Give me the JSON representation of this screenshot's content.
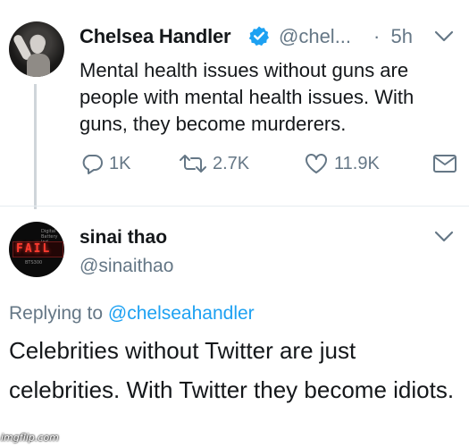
{
  "tweet": {
    "author_name": "Chelsea Handler",
    "author_handle": "@chel...",
    "separator": "·",
    "time": "5h",
    "text": "Mental health issues without guns are people with mental health issues. With guns, they become murderers.",
    "replies_count": "1K",
    "retweets_count": "2.7K",
    "likes_count": "11.9K",
    "icons": {
      "verified": "verified-badge-icon",
      "menu": "chevron-down-icon",
      "reply": "reply-icon",
      "retweet": "retweet-icon",
      "like": "heart-icon",
      "message": "envelope-icon"
    }
  },
  "reply_tweet": {
    "author_name": "sinai thao",
    "author_handle": "@sinaithao",
    "replying_prefix": "Replying to",
    "replying_to": "@chelseahandler",
    "text": "Celebrities without Twitter are just celebrities. With Twitter they become idiots.",
    "avatar": {
      "sign_text": "FAIL",
      "small_text_1": "Digital",
      "small_text_2": "Battery Ind",
      "small_text_3": "BTS300"
    }
  },
  "watermark": "imgflip.com",
  "colors": {
    "text": "#14171a",
    "secondary": "#657786",
    "accent": "#1da1f2",
    "divider": "#e6ecf0"
  }
}
